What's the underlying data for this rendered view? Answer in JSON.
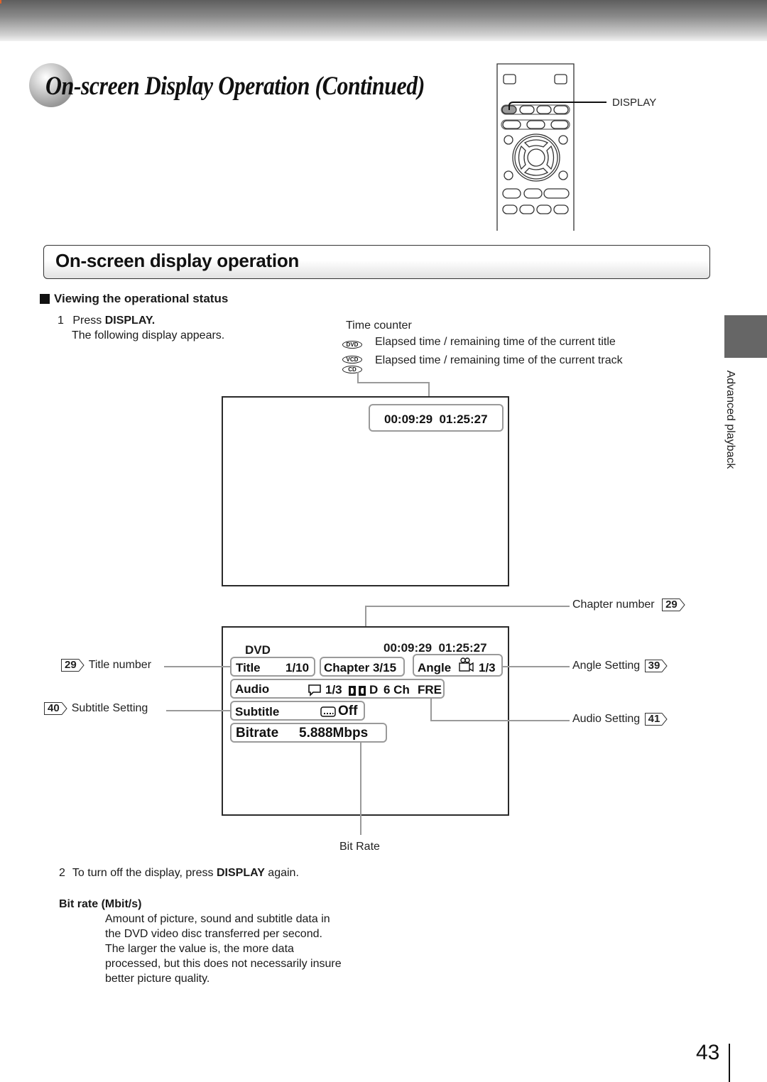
{
  "page": {
    "title": "On-screen Display Operation (Continued)",
    "page_number": "43",
    "side_tab_label": "Advanced playback"
  },
  "remote": {
    "callout_label": "DISPLAY",
    "highlighted_button": "DISPLAY"
  },
  "section": {
    "title": "On-screen display operation",
    "subheading": "Viewing the operational status"
  },
  "steps": {
    "step1_number": "1",
    "step1_prefix": "Press ",
    "step1_key": "DISPLAY.",
    "step1_result": "The following display appears.",
    "step2_number": "2",
    "step2_prefix": "To turn off the display, press ",
    "step2_key": "DISPLAY",
    "step2_suffix": " again."
  },
  "time_counter": {
    "heading": "Time counter",
    "dvd_badge": "DVD",
    "dvd_desc": "Elapsed time / remaining time of the current title",
    "vcd_badge": "VCD",
    "cd_badge": "CD",
    "vcd_cd_desc": "Elapsed time / remaining time of the current track"
  },
  "screen1": {
    "elapsed": "00:09:29",
    "remaining": "01:25:27"
  },
  "screen2": {
    "disc_type": "DVD",
    "elapsed": "00:09:29",
    "remaining": "01:25:27",
    "title_label": "Title",
    "title_value": "1/10",
    "chapter_label": "Chapter",
    "chapter_value": "3/15",
    "angle_label": "Angle",
    "angle_icon": "camera-icon",
    "angle_value": "1/3",
    "audio_label": "Audio",
    "audio_icon": "speech-bubble-icon",
    "audio_track": "1/3",
    "audio_format_icon": "dolby-digital-icon",
    "audio_format": "D",
    "audio_channels": "6 Ch",
    "audio_language": "FRE",
    "subtitle_label": "Subtitle",
    "subtitle_icon": "subtitle-icon",
    "subtitle_value": "Off",
    "bitrate_label": "Bitrate",
    "bitrate_value": "5.888Mbps"
  },
  "callouts": {
    "title_number": {
      "label": "Title number",
      "ref": "29"
    },
    "subtitle_setting": {
      "label": "Subtitle Setting",
      "ref": "40"
    },
    "chapter_number": {
      "label": "Chapter number",
      "ref": "29"
    },
    "angle_setting": {
      "label": "Angle Setting",
      "ref": "39"
    },
    "audio_setting": {
      "label": "Audio Setting",
      "ref": "41"
    },
    "bit_rate": {
      "label": "Bit Rate"
    }
  },
  "bitrate_note": {
    "heading": "Bit rate (Mbit/s)",
    "lines": [
      "Amount of picture, sound and subtitle data in",
      "the DVD video disc transferred per second.",
      "The larger the value is, the more data",
      "processed, but this does not necessarily insure",
      "better picture quality."
    ]
  }
}
